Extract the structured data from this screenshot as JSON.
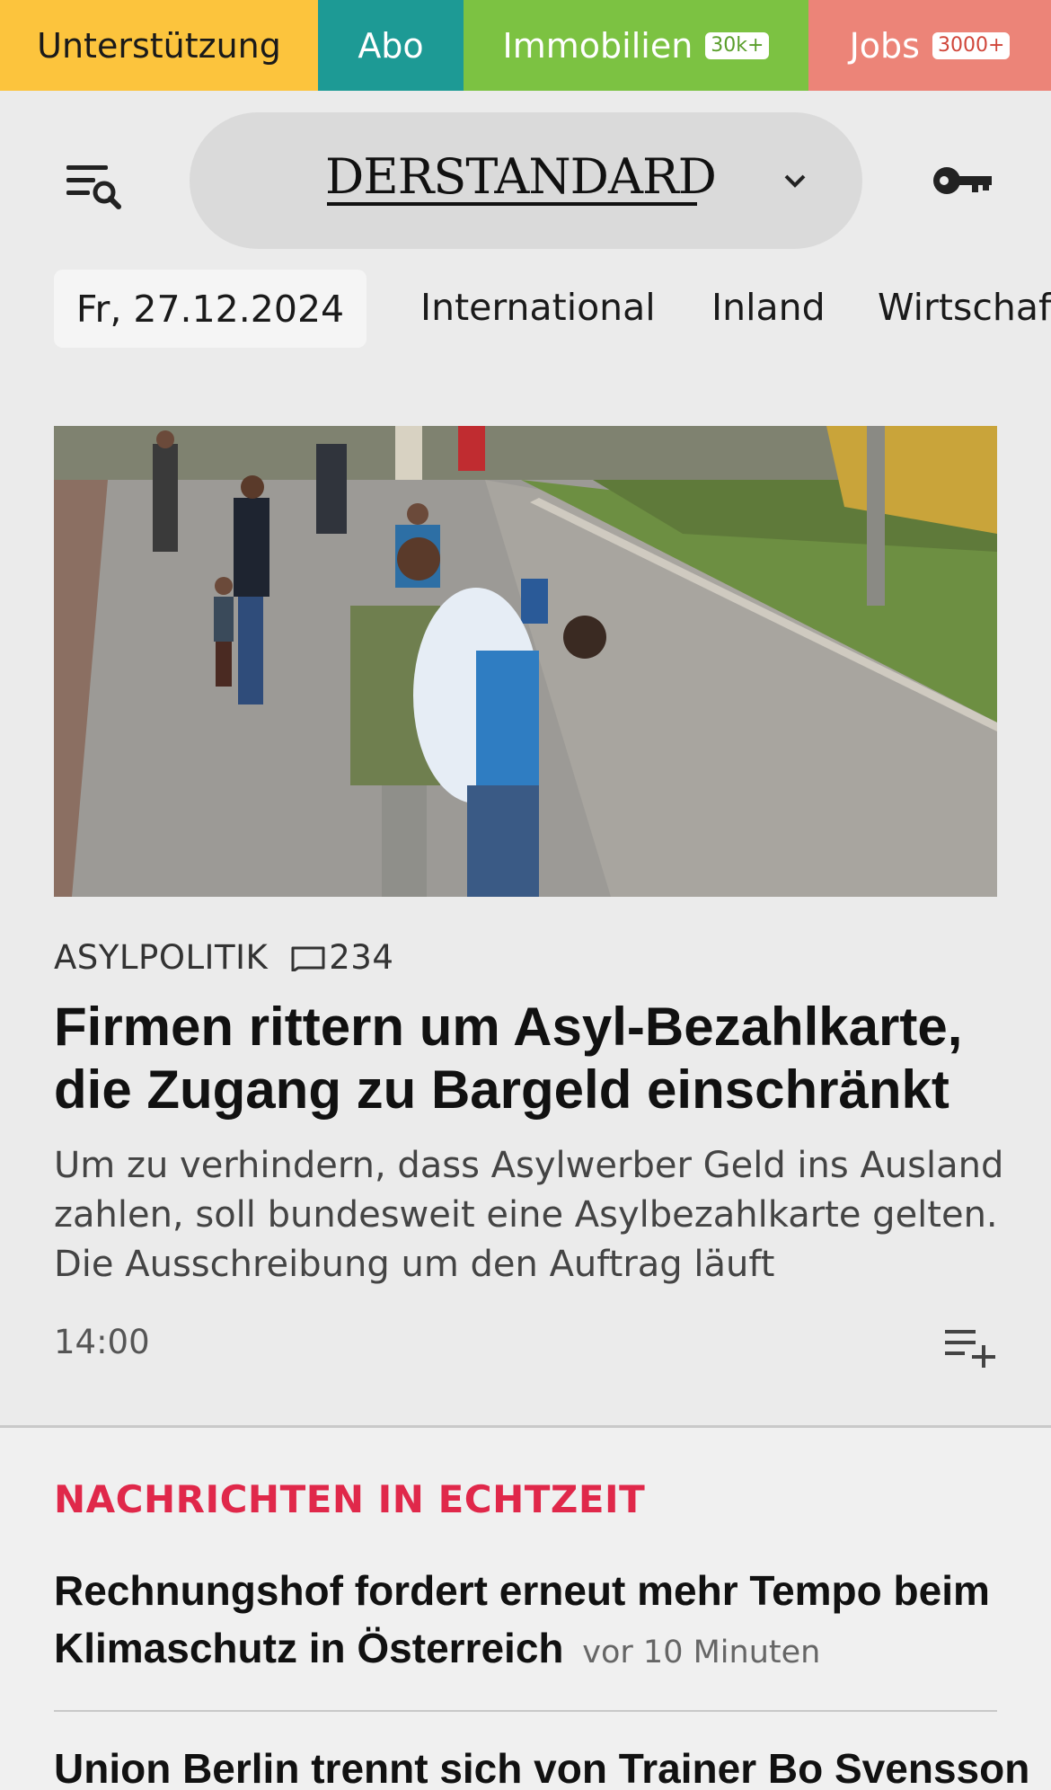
{
  "topbar": {
    "support": "Unterstützung",
    "abo": "Abo",
    "immobilien": "Immobilien",
    "immobilien_badge": "30k+",
    "jobs": "Jobs",
    "jobs_badge": "3000+"
  },
  "header": {
    "logo": "DERSTANDARD"
  },
  "nav": {
    "date": "Fr, 27.12.2024",
    "items": [
      "International",
      "Inland",
      "Wirtschaft"
    ]
  },
  "lead_article": {
    "kicker": "ASYLPOLITIK",
    "comments": "234",
    "headline": "Firmen rittern um Asyl-Bezahlkarte, die Zugang zu Bargeld einschränkt",
    "teaser": "Um zu verhindern, dass Asylwerber Geld ins Ausland zahlen, soll bundesweit eine Asylbezahlkarte gelten. Die Ausschreibung um den Auftrag läuft",
    "time": "14:00"
  },
  "live": {
    "title": "NACHRICHTEN IN ECHTZEIT",
    "items": [
      {
        "headline": "Rechnungshof fordert erneut mehr Tempo beim Klimaschutz in Österreich",
        "age": "vor 10 Minuten"
      },
      {
        "headline": "Union Berlin trennt sich von Trainer Bo Svensson"
      }
    ]
  },
  "colors": {
    "support": "#fcc43d",
    "abo": "#1d9a95",
    "immobilien": "#7cc242",
    "jobs": "#ec8478",
    "live_accent": "#e0284a"
  },
  "icons": [
    "menu-search-icon",
    "chevron-down-icon",
    "key-icon",
    "comment-icon",
    "add-to-list-icon"
  ]
}
